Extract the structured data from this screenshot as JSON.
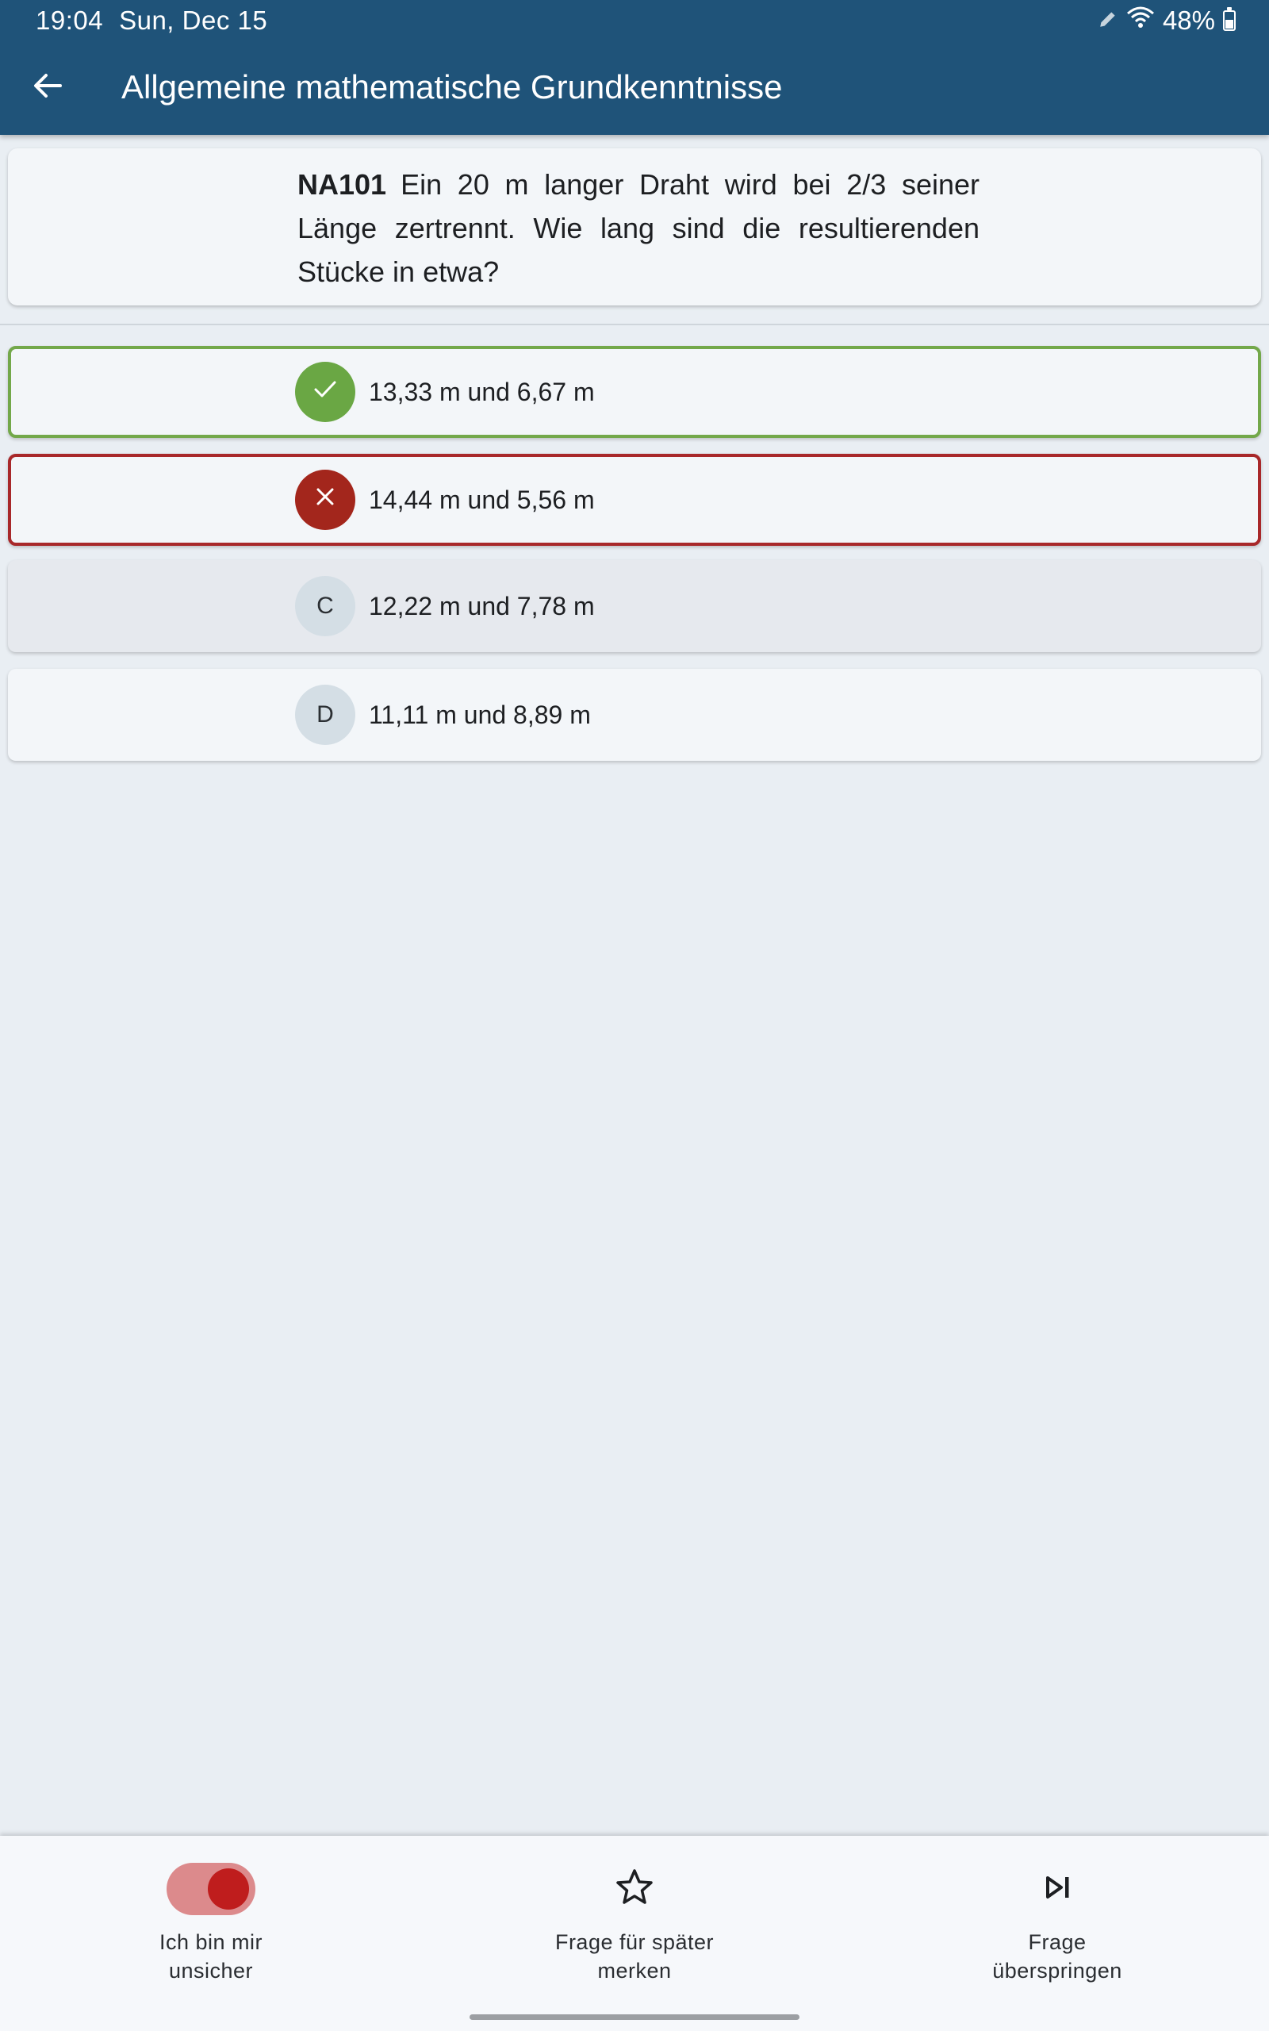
{
  "status_bar": {
    "time": "19:04",
    "date": "Sun, Dec 15",
    "battery": "48%",
    "icons": [
      "pencil-icon",
      "wifi-icon",
      "battery-icon"
    ]
  },
  "app_bar": {
    "back_icon": "arrow-left-icon",
    "title": "Allgemeine mathematische Grundkenntnisse"
  },
  "question": {
    "id": "NA101",
    "text": "Ein 20 m langer Draht wird bei 2/3 seiner Länge zertrennt. Wie lang sind die resultierenden Stücke in etwa?"
  },
  "answers": [
    {
      "badge": "",
      "icon": "check-icon",
      "text": "13,33 m und 6,67 m",
      "state": "correct"
    },
    {
      "badge": "",
      "icon": "close-icon",
      "text": "14,44 m und 5,56 m",
      "state": "wrong"
    },
    {
      "badge": "C",
      "icon": "",
      "text": "12,22 m und 7,78 m",
      "state": "neutral"
    },
    {
      "badge": "D",
      "icon": "",
      "text": "11,11 m und 8,89 m",
      "state": "neutral"
    }
  ],
  "bottom_bar": {
    "unsure": {
      "label": "Ich bin mir\nunsicher",
      "toggle_on": true
    },
    "bookmark": {
      "label": "Frage für später\nmerken",
      "icon": "star-outline-icon"
    },
    "skip": {
      "label": "Frage\nüberspringen",
      "icon": "skip-next-icon"
    }
  },
  "colors": {
    "app_bar": "#1f5379",
    "correct": "#6aa744",
    "wrong": "#a3261c",
    "toggle_track": "#dc8a8c",
    "toggle_knob": "#bf1d1d"
  }
}
